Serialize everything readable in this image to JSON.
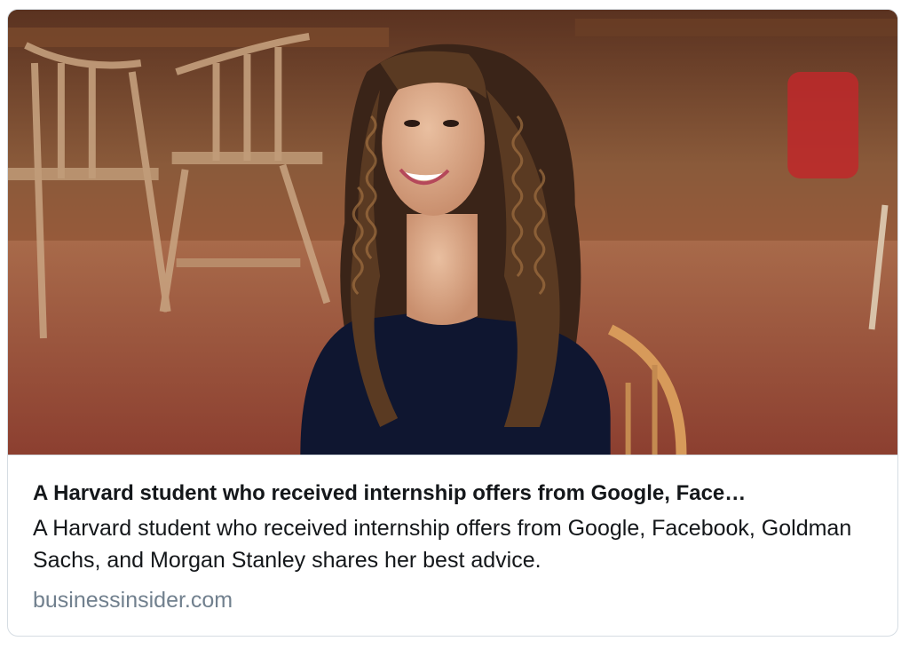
{
  "card": {
    "image": {
      "alt": "",
      "icon": "photo-icon"
    },
    "headline": "A Harvard student who received internship offers from Google, Face…",
    "description": "A Harvard student who received internship offers from Google, Facebook, Goldman Sachs, and Morgan Stanley shares her best advice.",
    "domain": "businessinsider.com"
  },
  "colors": {
    "border": "#d6dde3",
    "text": "#14171a",
    "domain": "#71808e"
  }
}
